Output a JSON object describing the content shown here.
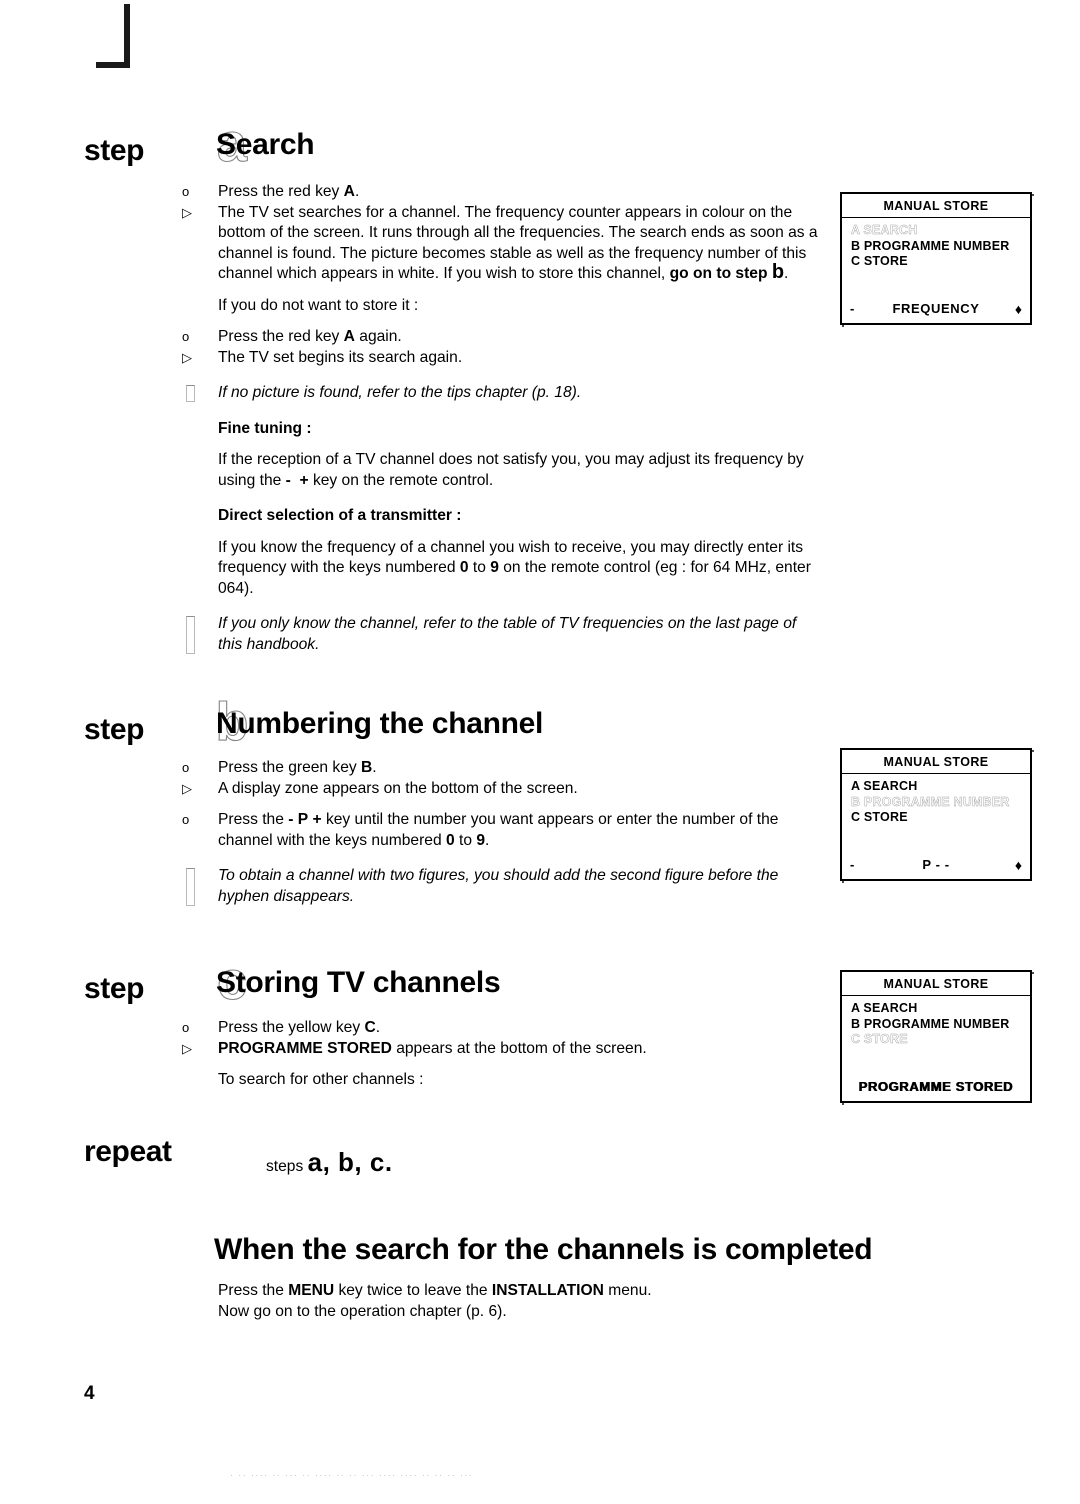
{
  "page": {
    "number": "4",
    "crop_mark": "crop-mark",
    "scan_artifact": "· ·· ···· ·· ··· ·· ···· ·· ·· ··· ···· ···· ·· ·· ·· ···"
  },
  "steps": [
    {
      "id": "a",
      "step_word": "step",
      "letter": "a",
      "title": "Search",
      "items": [
        {
          "marker": "o",
          "type": "bullet",
          "text_parts": [
            {
              "t": "Press the red key "
            },
            {
              "t": "A",
              "bold": true
            },
            {
              "t": "."
            }
          ]
        },
        {
          "marker": "▷",
          "type": "result",
          "text_parts": [
            {
              "t": "The TV set searches for a channel. The frequency counter appears in colour on the bottom of the screen. It runs through all the frequencies. The search ends as soon as a channel is found. The picture becomes stable as well as the frequency number of this channel which appears in white. If you wish to store this channel, "
            },
            {
              "t": "go on to step ",
              "bold": true
            },
            {
              "t": "b",
              "bold": true,
              "big": true
            },
            {
              "t": "."
            }
          ]
        },
        {
          "marker": "",
          "type": "plain",
          "text_parts": [
            {
              "t": "If you do not want to store it :"
            }
          ]
        },
        {
          "marker": "o",
          "type": "bullet",
          "text_parts": [
            {
              "t": "Press the red key "
            },
            {
              "t": "A",
              "bold": true
            },
            {
              "t": " again."
            }
          ]
        },
        {
          "marker": "▷",
          "type": "result",
          "text_parts": [
            {
              "t": "The TV set begins its search again."
            }
          ]
        },
        {
          "marker": "note",
          "type": "note",
          "text_parts": [
            {
              "t": "If no picture is found, refer to the tips chapter (p. 18)."
            }
          ]
        },
        {
          "marker": "",
          "type": "subhead",
          "text_parts": [
            {
              "t": "Fine tuning :"
            }
          ]
        },
        {
          "marker": "",
          "type": "plain",
          "text_parts": [
            {
              "t": "If the reception of a TV channel does not satisfy you, you may adjust its frequency by using the "
            },
            {
              "t": "-",
              "bold": true
            },
            {
              "t": "  "
            },
            {
              "t": "+",
              "bold": true
            },
            {
              "t": " key on the remote control."
            }
          ]
        },
        {
          "marker": "",
          "type": "subhead",
          "text_parts": [
            {
              "t": "Direct selection of a transmitter :"
            }
          ]
        },
        {
          "marker": "",
          "type": "plain",
          "text_parts": [
            {
              "t": "If you know the frequency of a channel you wish to receive, you may directly enter its frequency with the keys numbered "
            },
            {
              "t": "0",
              "bold": true
            },
            {
              "t": " to "
            },
            {
              "t": "9",
              "bold": true
            },
            {
              "t": " on the remote control (eg : for 64 MHz, enter 064)."
            }
          ]
        },
        {
          "marker": "note",
          "type": "note-tall",
          "text_parts": [
            {
              "t": "If you only know the channel, refer to the table of TV frequencies on the last page of this handbook."
            }
          ]
        }
      ]
    },
    {
      "id": "b",
      "step_word": "step",
      "letter": "b",
      "title": "Numbering the channel",
      "items": [
        {
          "marker": "o",
          "type": "bullet",
          "text_parts": [
            {
              "t": "Press the green key "
            },
            {
              "t": "B",
              "bold": true
            },
            {
              "t": "."
            }
          ]
        },
        {
          "marker": "▷",
          "type": "result",
          "text_parts": [
            {
              "t": "A display zone appears on the bottom of the screen."
            }
          ]
        },
        {
          "marker": "o",
          "type": "bullet",
          "text_parts": [
            {
              "t": "Press the "
            },
            {
              "t": "-",
              "bold": true
            },
            {
              "t": " "
            },
            {
              "t": "P",
              "bold": true
            },
            {
              "t": " "
            },
            {
              "t": "+",
              "bold": true
            },
            {
              "t": " key until the number you want appears or enter the number of the channel with the keys numbered "
            },
            {
              "t": "0",
              "bold": true
            },
            {
              "t": " to "
            },
            {
              "t": "9",
              "bold": true
            },
            {
              "t": "."
            }
          ]
        },
        {
          "marker": "note",
          "type": "note-tall",
          "text_parts": [
            {
              "t": "To obtain a channel with two figures, you should add the second figure before the hyphen disappears."
            }
          ]
        }
      ]
    },
    {
      "id": "c",
      "step_word": "step",
      "letter": "c",
      "title": "Storing TV channels",
      "items": [
        {
          "marker": "o",
          "type": "bullet",
          "text_parts": [
            {
              "t": "Press the yellow key "
            },
            {
              "t": "C",
              "bold": true
            },
            {
              "t": "."
            }
          ]
        },
        {
          "marker": "▷",
          "type": "result",
          "text_parts": [
            {
              "t": "PROGRAMME STORED",
              "bold": true
            },
            {
              "t": " appears at the bottom of the screen."
            }
          ]
        },
        {
          "marker": "",
          "type": "plain",
          "text_parts": [
            {
              "t": "To search for other channels :"
            }
          ]
        }
      ]
    }
  ],
  "repeat": {
    "word": "repeat",
    "label": "steps",
    "letters": "a, b, c."
  },
  "final": {
    "heading": "When the search for the channels is completed",
    "items": [
      {
        "marker": "o",
        "text_parts": [
          {
            "t": "Press the "
          },
          {
            "t": "MENU",
            "bold": true
          },
          {
            "t": " key twice to leave the "
          },
          {
            "t": "INSTALLATION",
            "bold": true
          },
          {
            "t": " menu."
          },
          {
            "t": "\n"
          },
          {
            "t": "Now go on to the operation chapter (p. 6)."
          }
        ]
      }
    ]
  },
  "tv_boxes": [
    {
      "id": "box-frequency",
      "title": "MANUAL STORE",
      "rows": [
        {
          "text": "A SEARCH",
          "faded": true
        },
        {
          "text": "B PROGRAMME NUMBER",
          "faded": false
        },
        {
          "text": "C STORE",
          "faded": false
        }
      ],
      "footer": {
        "left": "-",
        "center": "FREQUENCY",
        "right": "♦",
        "bold_blur": false
      }
    },
    {
      "id": "box-programme-number",
      "title": "MANUAL STORE",
      "rows": [
        {
          "text": "A SEARCH",
          "faded": false
        },
        {
          "text": "B PROGRAMME NUMBER",
          "faded": true
        },
        {
          "text": "C STORE",
          "faded": false
        }
      ],
      "footer": {
        "left": "-",
        "center": "P - -",
        "right": "♦",
        "bold_blur": false
      }
    },
    {
      "id": "box-programme-stored",
      "title": "MANUAL STORE",
      "rows": [
        {
          "text": "A SEARCH",
          "faded": false
        },
        {
          "text": "B PROGRAMME NUMBER",
          "faded": false
        },
        {
          "text": "C STORE",
          "faded": true
        }
      ],
      "footer": {
        "left": "",
        "center": "PROGRAMME STORED",
        "right": "",
        "bold_blur": true
      }
    }
  ]
}
